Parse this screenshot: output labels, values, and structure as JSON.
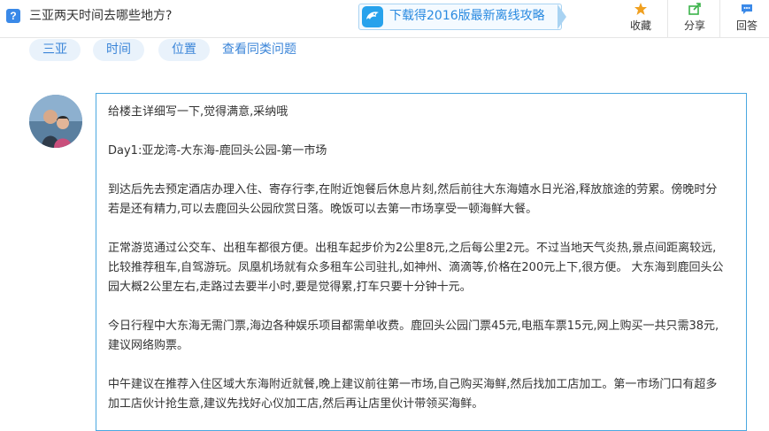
{
  "header": {
    "question_icon": "question-icon",
    "title": "三亚两天时间去哪些地方?",
    "promo": {
      "logo_icon": "dolphin-logo-icon",
      "text": "下载得2016版最新离线攻略"
    },
    "tools": [
      {
        "icon": "star-icon",
        "label": "收藏"
      },
      {
        "icon": "share-icon",
        "label": "分享"
      },
      {
        "icon": "chat-bubble-icon",
        "label": "回答"
      }
    ]
  },
  "tags": [
    "三亚",
    "时间",
    "位置"
  ],
  "similar_link": "查看同类问题",
  "answer": {
    "paragraphs": [
      "给楼主详细写一下,觉得满意,采纳哦",
      "Day1:亚龙湾-大东海-鹿回头公园-第一市场",
      "到达后先去预定酒店办理入住、寄存行李,在附近饱餐后休息片刻,然后前往大东海嬉水日光浴,释放旅途的劳累。傍晚时分若是还有精力,可以去鹿回头公园欣赏日落。晚饭可以去第一市场享受一顿海鲜大餐。",
      "正常游览通过公交车、出租车都很方便。出租车起步价为2公里8元,之后每公里2元。不过当地天气炎热,景点间距离较远,比较推荐租车,自驾游玩。凤凰机场就有众多租车公司驻扎,如神州、滴滴等,价格在200元上下,很方便。 大东海到鹿回头公园大概2公里左右,走路过去要半小时,要是觉得累,打车只要十分钟十元。",
      "今日行程中大东海无需门票,海边各种娱乐项目都需单收费。鹿回头公园门票45元,电瓶车票15元,网上购买一共只需38元,建议网络购票。",
      "中午建议在推荐入住区域大东海附近就餐,晚上建议前往第一市场,自己购买海鲜,然后找加工店加工。第一市场门口有超多加工店伙计抢生意,建议先找好心仪加工店,然后再让店里伙计带领买海鲜。"
    ]
  },
  "colors": {
    "accent": "#3b85d8",
    "border": "#4aa7e0",
    "tag_bg": "#e9f2fb",
    "star": "#f0a020",
    "share": "#3bb34a"
  }
}
